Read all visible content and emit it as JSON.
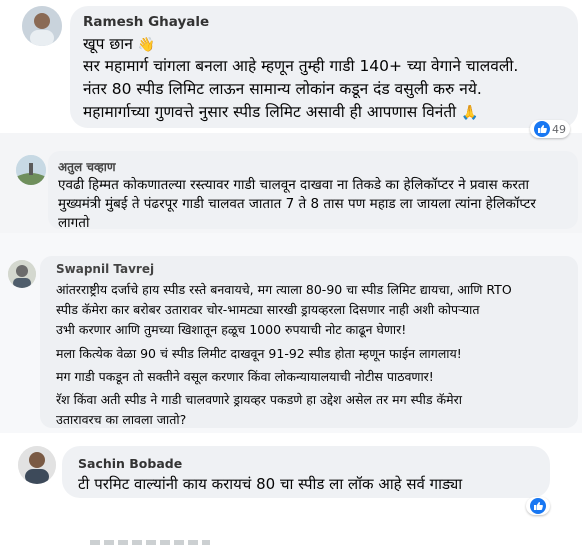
{
  "comments": [
    {
      "author": "Ramesh Ghayale",
      "lines": [
        "खूप छान",
        "सर महामार्ग चांगला बनला आहे म्हणून तुम्ही गाडी 140+ च्या वेगाने चालवली.",
        "नंतर 80 स्पीड लिमिट लाऊन सामान्य लोकांन कडून दंड वसुली करु नये.",
        "महामार्गाच्या गुणवत्ते नुसार स्पीड लिमिट असावी ही आपणास विनंती"
      ],
      "reaction_count": "49"
    },
    {
      "author": "अतुल चव्हाण",
      "lines": [
        "एवढी हिम्मत कोकणातल्या रस्त्यावर गाडी चालवून दाखवा ना तिकडे का हेलिकॉप्टर ने प्रवास करता",
        "मुख्यमंत्री मुंबई ते पंढरपूर गाडी चालवत जातात 7 ते 8 तास पण महाड ला जायला त्यांना हेलिकॉप्टर",
        "लागतो"
      ]
    },
    {
      "author": "Swapnil Tavrej",
      "lines": [
        "आंतरराष्ट्रीय दर्जाचे हाय स्पीड रस्ते बनवायचे, मग त्याला 80-90 चा स्पीड लिमिट द्यायचा, आणि RTO",
        "स्पीड कॅमेरा कार बरोबर उतारावर चोर-भामट्या सारखी ड्रायव्हरला दिसणार नाही अशी कोपऱ्यात",
        "उभी करणार आणि तुमच्या खिशातून हळूच 1000 रुपयाची नोट काढून घेणार!",
        "मला कित्येक वेळा 90 चं स्पीड लिमीट दाखवून 91-92 स्पीड होता म्हणून फाईन लागलाय!",
        "मग गाडी पकडून तो सक्तीने वसूल करणार किंवा लोकन्यायालयाची नोटीस पाठवणार!",
        "रॅश किंवा अती स्पीड ने गाडी चालवणारे ड्रायव्हर पकडणे हा उद्देश असेल तर मग स्पीड कॅमेरा",
        "उतारावरच का लावला जातो?"
      ]
    },
    {
      "author": "Sachin Bobade",
      "lines": [
        "टी परमिट वाल्यांनी काय करायचं 80 चा स्पीड ला लॉक आहे सर्व गाड्या"
      ]
    }
  ],
  "icons": {
    "wave": "waving-hand-icon",
    "pray": "folded-hands-icon",
    "like": "like-reaction-icon"
  },
  "colors": {
    "bubble": "#eff1f4",
    "like_blue": "#1877f2",
    "text": "#050505"
  }
}
